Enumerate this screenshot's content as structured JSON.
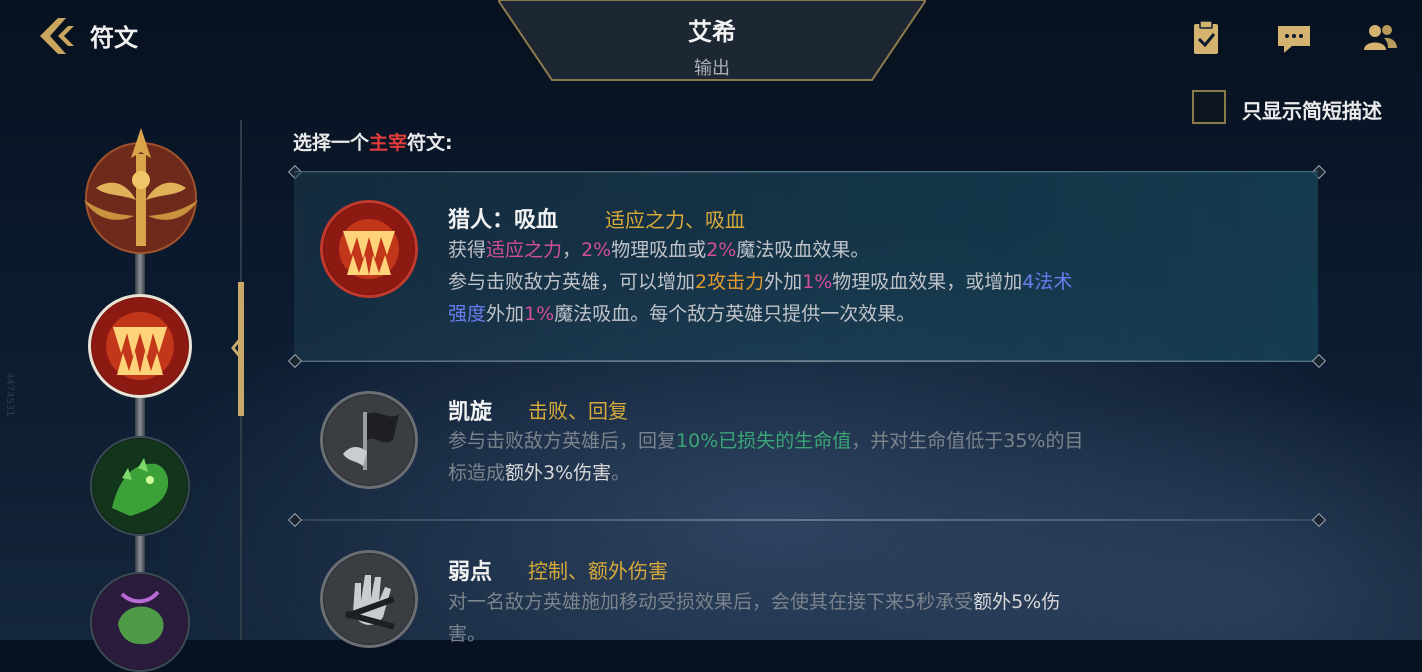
{
  "header": {
    "title": "符文",
    "champion_name": "艾希",
    "champion_role": "输出",
    "icons": [
      "quest-clipboard-icon",
      "chat-icon",
      "friends-icon"
    ]
  },
  "filter": {
    "checkbox_label": "只显示简短描述",
    "checked": false
  },
  "prompt": {
    "prefix": "选择一个",
    "highlight": "主宰",
    "suffix": "符文:"
  },
  "sidebar": {
    "runes": [
      "domination-tree-icon",
      "hunter-vampirism-icon",
      "triumph-beast-icon",
      "weakness-icon"
    ],
    "selected_index": 1
  },
  "runes": [
    {
      "name": "猎人：吸血",
      "tags": "适应之力、吸血",
      "icon": "fanged-maw-icon",
      "selected": true,
      "line1": {
        "a": "获得",
        "b": "适应之力",
        "c": "，",
        "d": "2%",
        "e": "物理吸血或",
        "f": "2%",
        "g": "魔法吸血效果。"
      },
      "line2": {
        "a": "参与击败敌方英雄，可以增加",
        "b": "2攻击力",
        "c": "外加",
        "d": "1%",
        "e": "物理吸血效果，或增加",
        "f": "4法术"
      },
      "line3": {
        "a": "强度",
        "b": "外加",
        "c": "1%",
        "d": "魔法吸血。每个敌方英雄只提供一次效果。"
      }
    },
    {
      "name": "凯旋",
      "tags": "击败、回复",
      "icon": "victory-flag-icon",
      "selected": false,
      "line1": {
        "a": "参与击败敌方英雄后，回复",
        "b": "10%已损失的生命值",
        "c": "，并对生命值低于35%的目"
      },
      "line2": {
        "a": "标造成",
        "b": "额外3%伤害",
        "c": "。"
      }
    },
    {
      "name": "弱点",
      "tags": "控制、额外伤害",
      "icon": "bound-hand-icon",
      "selected": false,
      "line1": {
        "a": "对一名敌方英雄施加移动受损效果后，会使其在接下来5秒承受",
        "b": "额外5%伤"
      },
      "line2": {
        "a": "害。"
      }
    }
  ],
  "watermark": "4474531"
}
